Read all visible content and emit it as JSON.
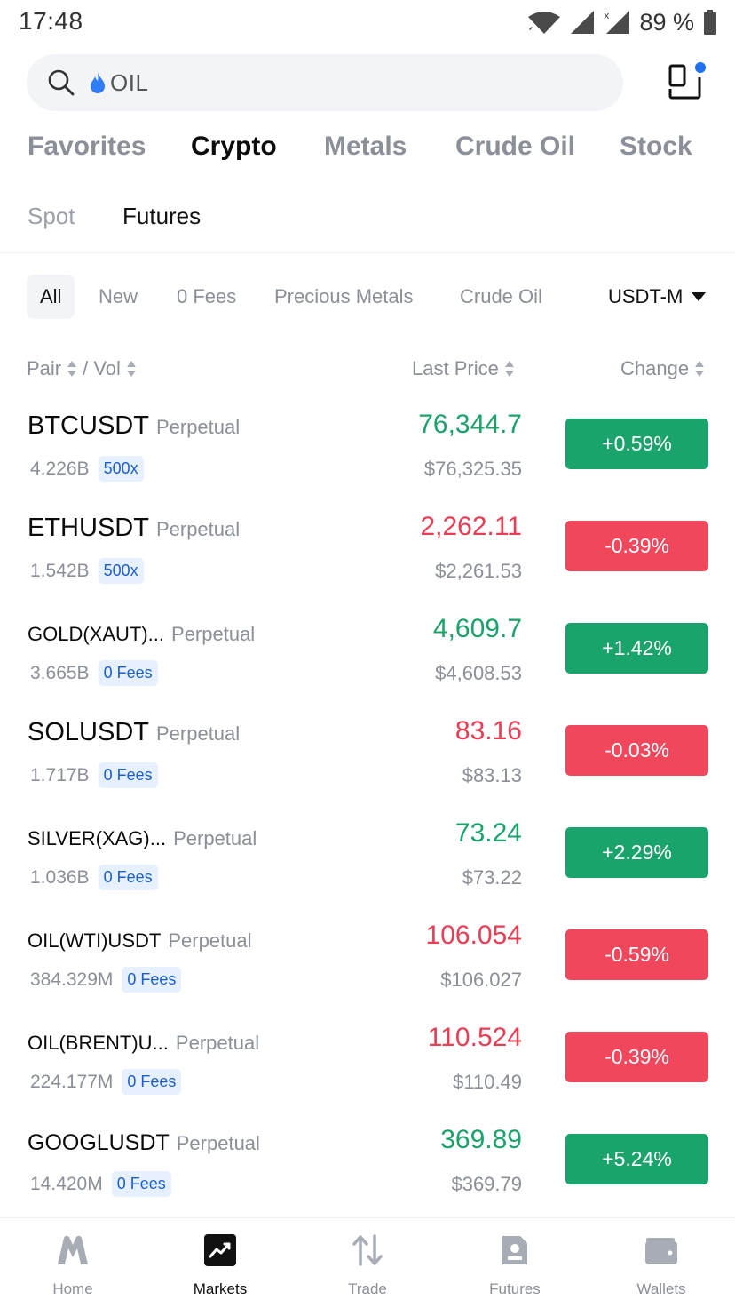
{
  "status_bar": {
    "time": "17:48",
    "battery": "89 %"
  },
  "search": {
    "text": "OIL"
  },
  "category_tabs": [
    "Favorites",
    "Crypto",
    "Metals",
    "Crude Oil",
    "Stock"
  ],
  "active_category": "Crypto",
  "sub_tabs": [
    "Spot",
    "Futures"
  ],
  "active_sub_tab": "Futures",
  "filters": [
    "All",
    "New",
    "0 Fees",
    "Precious Metals",
    "Crude Oil"
  ],
  "active_filter": "All",
  "margin_select": "USDT-M",
  "columns": {
    "pair": "Pair",
    "vol": "/ Vol",
    "last_price": "Last Price",
    "change": "Change"
  },
  "rows": [
    {
      "pair": "BTCUSDT",
      "type": "Perpetual",
      "vol": "4.226B",
      "badge": "500x",
      "last": "76,344.7",
      "usd": "$76,325.35",
      "change": "+0.59%",
      "dir": "up"
    },
    {
      "pair": "ETHUSDT",
      "type": "Perpetual",
      "vol": "1.542B",
      "badge": "500x",
      "last": "2,262.11",
      "usd": "$2,261.53",
      "change": "-0.39%",
      "dir": "down"
    },
    {
      "pair": "GOLD(XAUT)...",
      "type": "Perpetual",
      "vol": "3.665B",
      "badge": "0 Fees",
      "last": "4,609.7",
      "usd": "$4,608.53",
      "change": "+1.42%",
      "dir": "up"
    },
    {
      "pair": "SOLUSDT",
      "type": "Perpetual",
      "vol": "1.717B",
      "badge": "0 Fees",
      "last": "83.16",
      "usd": "$83.13",
      "change": "-0.03%",
      "dir": "down"
    },
    {
      "pair": "SILVER(XAG)...",
      "type": "Perpetual",
      "vol": "1.036B",
      "badge": "0 Fees",
      "last": "73.24",
      "usd": "$73.22",
      "change": "+2.29%",
      "dir": "up"
    },
    {
      "pair": "OIL(WTI)USDT",
      "type": "Perpetual",
      "vol": "384.329M",
      "badge": "0 Fees",
      "last": "106.054",
      "usd": "$106.027",
      "change": "-0.59%",
      "dir": "down"
    },
    {
      "pair": "OIL(BRENT)U...",
      "type": "Perpetual",
      "vol": "224.177M",
      "badge": "0 Fees",
      "last": "110.524",
      "usd": "$110.49",
      "change": "-0.39%",
      "dir": "down"
    },
    {
      "pair": "GOOGLUSDT",
      "type": "Perpetual",
      "vol": "14.420M",
      "badge": "0 Fees",
      "last": "369.89",
      "usd": "$369.79",
      "change": "+5.24%",
      "dir": "up"
    }
  ],
  "bottom_nav": [
    {
      "label": "Home",
      "icon": "home-logo-icon"
    },
    {
      "label": "Markets",
      "icon": "markets-chart-icon"
    },
    {
      "label": "Trade",
      "icon": "trade-arrows-icon"
    },
    {
      "label": "Futures",
      "icon": "futures-doc-icon"
    },
    {
      "label": "Wallets",
      "icon": "wallet-icon"
    }
  ],
  "active_nav": "Markets",
  "colors": {
    "up": "#1aa36a",
    "down": "#f0475d",
    "badge_text": "#1a5fd0",
    "badge_bg": "#e7f0ff",
    "notification_dot": "#1f6ff2"
  }
}
